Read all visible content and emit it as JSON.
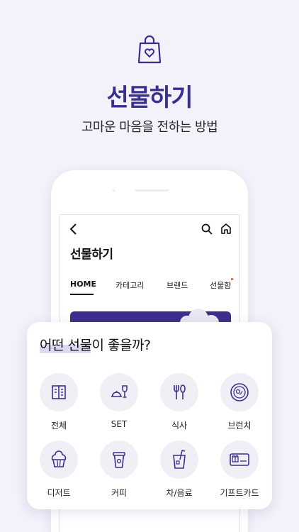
{
  "hero": {
    "title": "선물하기",
    "subtitle": "고마운 마음을 전하는 방법"
  },
  "screen": {
    "title": "선물하기",
    "tabs": [
      {
        "label": "HOME",
        "active": true
      },
      {
        "label": "카테고리"
      },
      {
        "label": "브랜드"
      },
      {
        "label": "선물함",
        "has_dot": true
      }
    ]
  },
  "card": {
    "title": "어떤 선물이 좋을까?",
    "categories": [
      {
        "label": "전체",
        "icon": "menu-book-icon"
      },
      {
        "label": "SET",
        "icon": "cloche-wine-icon"
      },
      {
        "label": "식사",
        "icon": "fork-spoon-icon"
      },
      {
        "label": "브런치",
        "icon": "plate-icon"
      },
      {
        "label": "디저트",
        "icon": "muffin-icon"
      },
      {
        "label": "커피",
        "icon": "coffee-cup-icon"
      },
      {
        "label": "차/음료",
        "icon": "drink-cup-icon"
      },
      {
        "label": "기프트카드",
        "icon": "gift-card-icon"
      }
    ]
  },
  "colors": {
    "brand": "#3a2f8f",
    "background": "#f1f2fa",
    "icon_circle": "#efeff6",
    "notification_dot": "#e0443c"
  }
}
